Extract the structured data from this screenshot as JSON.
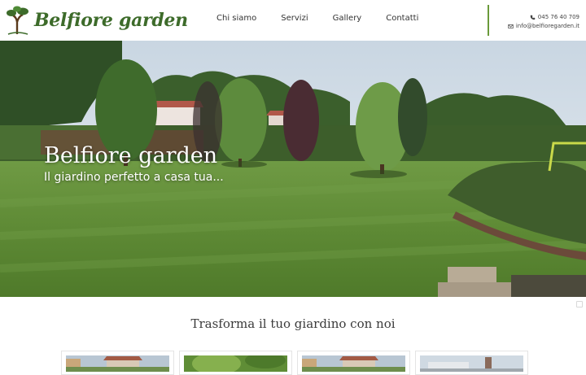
{
  "brand": {
    "name": "Belfiore garden"
  },
  "nav": {
    "items": [
      "Chi siamo",
      "Servizi",
      "Gallery",
      "Contatti"
    ]
  },
  "contact": {
    "phone": "045 76 40 709",
    "email": "info@belfioregarden.it"
  },
  "hero": {
    "title": "Belfiore garden",
    "subtitle": "Il giardino perfetto a casa tua..."
  },
  "section": {
    "title": "Trasforma il tuo giardino con noi"
  },
  "colors": {
    "brand_green": "#3d6b2a",
    "accent_divider": "#6a9a3a"
  },
  "icons": [
    "tree-logo-icon",
    "phone-icon",
    "mail-icon",
    "scroll-icon"
  ]
}
